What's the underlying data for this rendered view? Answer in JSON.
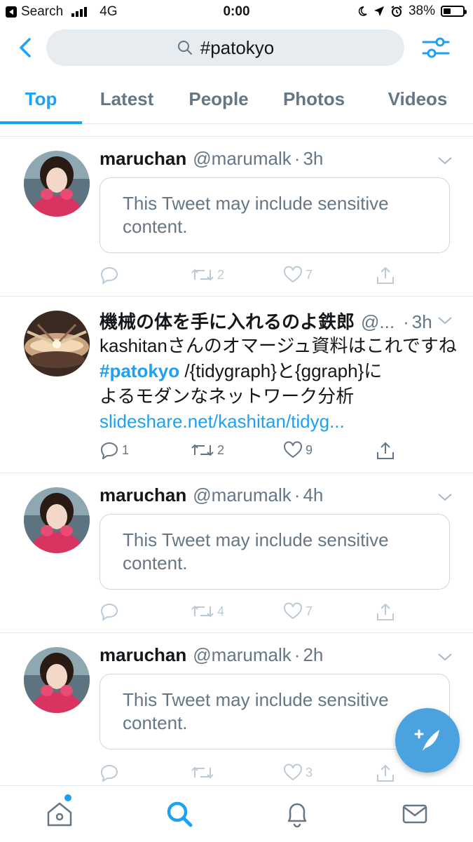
{
  "status_bar": {
    "back_label": "Search",
    "network": "4G",
    "time": "0:00",
    "battery": "38%",
    "battery_level": 0.38
  },
  "search": {
    "query": "#patokyo"
  },
  "tabs": [
    {
      "label": "Top",
      "active": true
    },
    {
      "label": "Latest"
    },
    {
      "label": "People"
    },
    {
      "label": "Photos"
    },
    {
      "label": "Videos"
    }
  ],
  "tweets": [
    {
      "name": "maruchan",
      "handle": "@marumalk",
      "time": "3h",
      "sensitive": "This Tweet may include sensitive content.",
      "replies": "",
      "retweets": "2",
      "likes": "7"
    },
    {
      "name": "機械の体を手に入れるのよ鉄郎",
      "handle": "@...",
      "time": "3h",
      "text_line1": "kashitanさんのオマージュ資料はこれですね",
      "hashtag": "#patokyo",
      "text_after_hashtag": "/{tidygraph}と{ggraph}に",
      "text_line3": "よるモダンなネットワーク分析",
      "link": "slideshare.net/kashitan/tidyg...",
      "replies": "1",
      "retweets": "2",
      "likes": "9"
    },
    {
      "name": "maruchan",
      "handle": "@marumalk",
      "time": "4h",
      "sensitive": "This Tweet may include sensitive content.",
      "replies": "",
      "retweets": "4",
      "likes": "7"
    },
    {
      "name": "maruchan",
      "handle": "@marumalk",
      "time": "2h",
      "sensitive": "This Tweet may include sensitive content.",
      "replies": "",
      "retweets": "",
      "likes": "3"
    }
  ],
  "colors": {
    "accent": "#1da1f2",
    "fab": "#4aa3df",
    "muted_text": "#657786",
    "search_bg": "#e6ecf0"
  },
  "bottom_nav": [
    "home-icon",
    "search-icon",
    "bell-icon",
    "mail-icon"
  ]
}
